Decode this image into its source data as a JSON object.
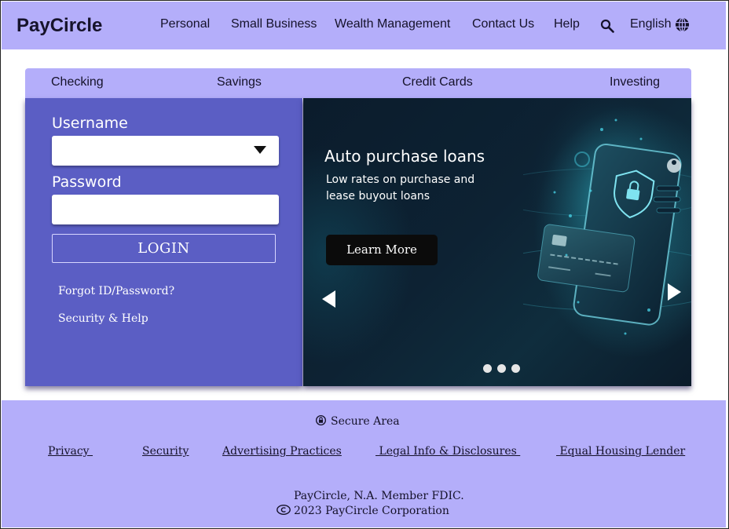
{
  "header": {
    "brand": "PayCircle",
    "nav": [
      "Personal",
      "Small Business",
      "Wealth Management",
      "Contact Us",
      "Help"
    ],
    "search_icon": "search-icon",
    "language": "English",
    "language_icon": "globe-icon"
  },
  "tabs": [
    "Checking",
    "Savings",
    "Credit Cards",
    "Investing"
  ],
  "login": {
    "username_label": "Username",
    "username_value": "",
    "password_label": "Password",
    "password_value": "",
    "login_button": "LOGIN",
    "forgot_link": "Forgot ID/Password?",
    "security_link": "Security & Help"
  },
  "hero": {
    "title": "Auto purchase loans",
    "subtitle": "Low rates on purchase and lease buyout loans",
    "cta": "Learn More",
    "slides_total": 3,
    "active_slide": 2
  },
  "footer": {
    "secure_area": "Secure Area",
    "links": [
      "Privacy ",
      "Security",
      "Advertising Practices",
      " Legal Info & Disclosures ",
      " Equal Housing Lender"
    ],
    "legal_line1": "PayCircle, N.A. Member FDIC.",
    "legal_line2": "2023 PayCircle Corporation"
  },
  "colors": {
    "lavender": "#b4aefa",
    "panel_blue": "#5b5ec4",
    "hero_dark": "#0d2233"
  }
}
